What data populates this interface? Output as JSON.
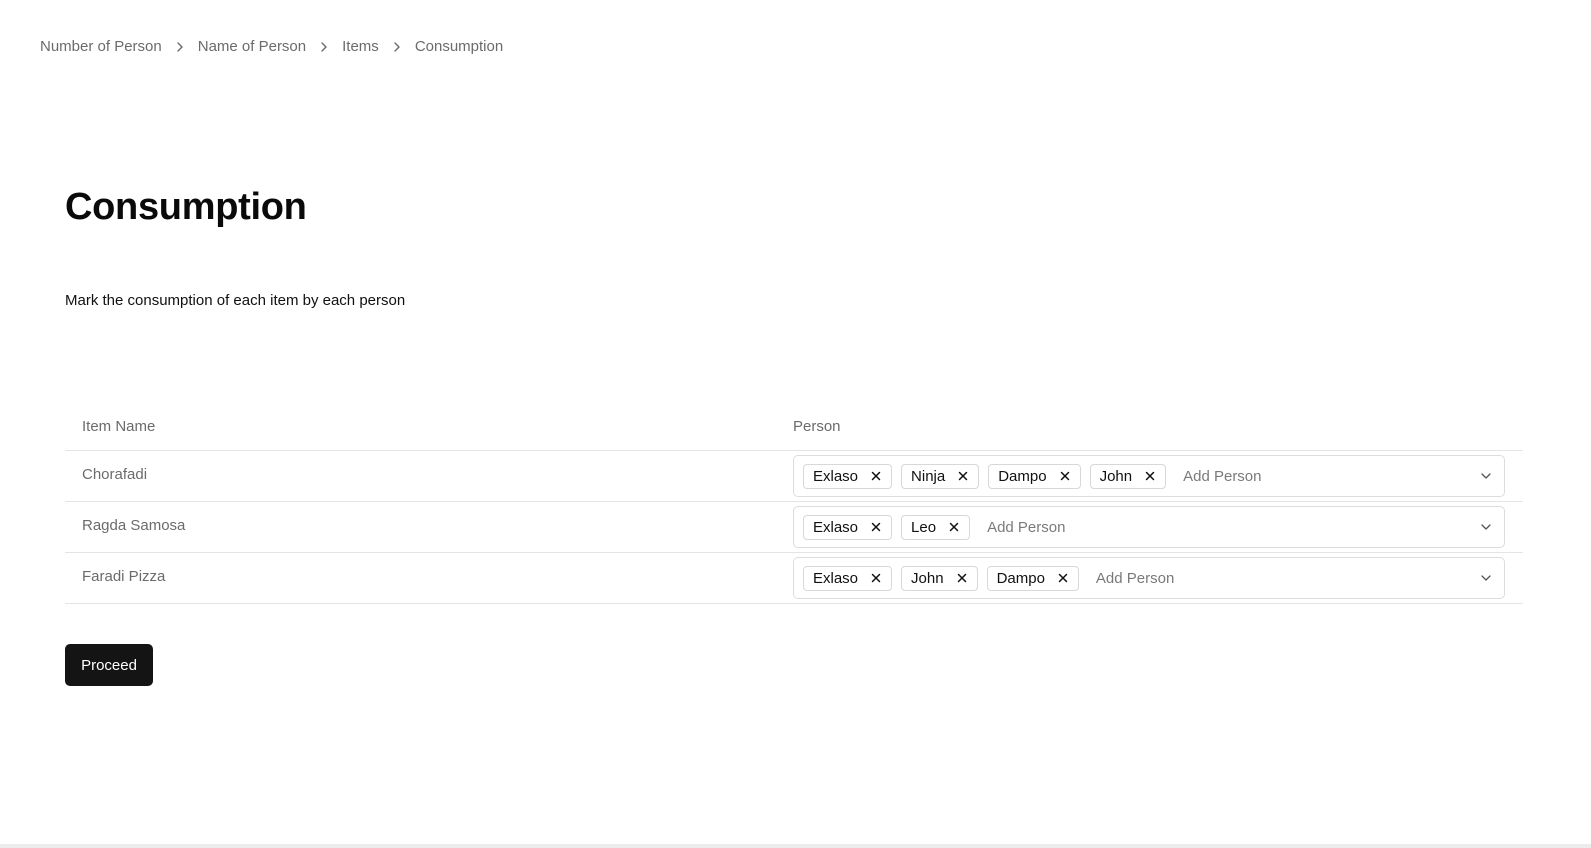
{
  "breadcrumb": [
    {
      "label": "Number of Person"
    },
    {
      "label": "Name of Person"
    },
    {
      "label": "Items"
    },
    {
      "label": "Consumption"
    }
  ],
  "page": {
    "title": "Consumption",
    "subtitle": "Mark the consumption of each item by each person"
  },
  "table": {
    "headers": {
      "item": "Item Name",
      "person": "Person"
    },
    "rows": [
      {
        "item": "Chorafadi",
        "persons": [
          "Exlaso",
          "Ninja",
          "Dampo",
          "John"
        ],
        "placeholder": "Add Person"
      },
      {
        "item": "Ragda Samosa",
        "persons": [
          "Exlaso",
          "Leo"
        ],
        "placeholder": "Add Person"
      },
      {
        "item": "Faradi Pizza",
        "persons": [
          "Exlaso",
          "John",
          "Dampo"
        ],
        "placeholder": "Add Person"
      }
    ]
  },
  "actions": {
    "proceed_label": "Proceed"
  },
  "icons": {
    "breadcrumb_separator": "chevron-right-icon",
    "tag_remove": "close-icon",
    "dropdown": "chevron-down-icon"
  },
  "colors": {
    "primary_button": "#141414",
    "muted_text": "#6b6b6b",
    "border": "#e4e4e4"
  }
}
